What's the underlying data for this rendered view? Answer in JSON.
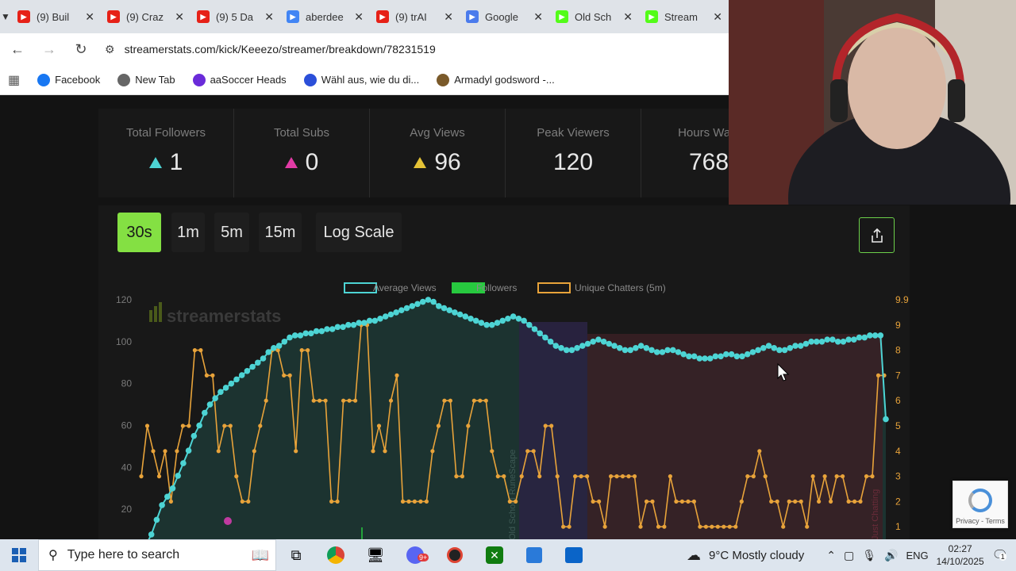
{
  "browser": {
    "tabs": [
      {
        "title": "(9) Buil",
        "icon": "youtube-icon",
        "color": "#e62117"
      },
      {
        "title": "(9) Craz",
        "icon": "youtube-icon",
        "color": "#e62117"
      },
      {
        "title": "(9) 5 Da",
        "icon": "youtube-icon",
        "color": "#e62117"
      },
      {
        "title": "aberdee",
        "icon": "google-icon",
        "color": "#4285f4"
      },
      {
        "title": "(9) trAI",
        "icon": "youtube-icon",
        "color": "#e62117"
      },
      {
        "title": "Google",
        "icon": "gemini-icon",
        "color": "#4b7bec"
      },
      {
        "title": "Old Sch",
        "icon": "kick-icon",
        "color": "#53fc18"
      },
      {
        "title": "Stream",
        "icon": "kick-icon",
        "color": "#53fc18"
      }
    ],
    "url": "streamerstats.com/kick/Keeezo/streamer/breakdown/78231519",
    "bookmarks": [
      {
        "label": "Facebook",
        "color": "#1877f2"
      },
      {
        "label": "New Tab",
        "color": "#666666"
      },
      {
        "label": "aaSoccer Heads",
        "color": "#6a2bd9"
      },
      {
        "label": "Wähl aus, wie du di...",
        "color": "#2b4fd9"
      },
      {
        "label": "Armadyl godsword -...",
        "color": "#7a5a2a"
      }
    ]
  },
  "stats": [
    {
      "label": "Total Followers",
      "value": "1",
      "marker": "#4dd4d4"
    },
    {
      "label": "Total Subs",
      "value": "0",
      "marker": "#e23ba6"
    },
    {
      "label": "Avg Views",
      "value": "96",
      "marker": "#e4c236"
    },
    {
      "label": "Peak Viewers",
      "value": "120",
      "marker": ""
    },
    {
      "label": "Hours Watc",
      "value": "768",
      "marker": ""
    }
  ],
  "controls": {
    "intervals": [
      "30s",
      "1m",
      "5m",
      "15m"
    ],
    "active_interval": "30s",
    "log_scale_label": "Log Scale"
  },
  "chart_data": {
    "type": "line",
    "watermark": "streamerstats",
    "series": [
      {
        "name": "Average Views",
        "axis": "left",
        "color": "#4dd4d4",
        "values": [
          3,
          8,
          15,
          22,
          26,
          30,
          36,
          42,
          48,
          55,
          60,
          66,
          70,
          73,
          76,
          78,
          80,
          82,
          84,
          86,
          88,
          90,
          92,
          95,
          97,
          98,
          100,
          102,
          103,
          103,
          104,
          104,
          105,
          105,
          106,
          106,
          107,
          107,
          108,
          108,
          109,
          109,
          110,
          110,
          111,
          112,
          113,
          114,
          115,
          116,
          117,
          118,
          119,
          120,
          119,
          117,
          116,
          115,
          114,
          113,
          112,
          111,
          110,
          109,
          108,
          108,
          109,
          110,
          111,
          112,
          111,
          110,
          108,
          106,
          104,
          102,
          100,
          98,
          97,
          96,
          96,
          97,
          98,
          99,
          100,
          101,
          100,
          99,
          98,
          97,
          96,
          96,
          97,
          98,
          97,
          96,
          95,
          95,
          96,
          96,
          95,
          94,
          93,
          93,
          92,
          92,
          92,
          93,
          93,
          94,
          94,
          93,
          93,
          94,
          95,
          96,
          97,
          98,
          97,
          96,
          96,
          97,
          98,
          98,
          99,
          100,
          100,
          100,
          101,
          101,
          100,
          100,
          101,
          101,
          102,
          102,
          103,
          103,
          103,
          63
        ]
      },
      {
        "name": "Followers",
        "axis": "right",
        "color": "#27c93f",
        "values": []
      },
      {
        "name": "Unique Chatters (5m)",
        "axis": "right",
        "color": "#e8a33a",
        "values": [
          3,
          5,
          4,
          3,
          4,
          2,
          4,
          5,
          5,
          8,
          8,
          7,
          7,
          4,
          5,
          5,
          3,
          2,
          2,
          4,
          5,
          6,
          8,
          8,
          7,
          7,
          4,
          8,
          8,
          6,
          6,
          6,
          2,
          2,
          6,
          6,
          6,
          9,
          9,
          4,
          5,
          4,
          6,
          7,
          2,
          2,
          2,
          2,
          2,
          4,
          5,
          6,
          6,
          3,
          3,
          5,
          6,
          6,
          6,
          4,
          3,
          3,
          2,
          2,
          3,
          4,
          4,
          3,
          5,
          5,
          3,
          1,
          1,
          3,
          3,
          3,
          2,
          2,
          1,
          3,
          3,
          3,
          3,
          3,
          1,
          2,
          2,
          1,
          1,
          3,
          2,
          2,
          2,
          2,
          1,
          1,
          1,
          1,
          1,
          1,
          1,
          2,
          3,
          3,
          4,
          3,
          2,
          2,
          1,
          2,
          2,
          2,
          1,
          3,
          2,
          3,
          2,
          3,
          3,
          2,
          2,
          2,
          3,
          3,
          7,
          7
        ]
      }
    ],
    "y_left": {
      "min": 0,
      "max": 120,
      "ticks": [
        "20",
        "40",
        "60",
        "80",
        "100",
        "120"
      ]
    },
    "y_right": {
      "ticks": [
        "1",
        "2",
        "3",
        "4",
        "5",
        "6",
        "7",
        "8",
        "9",
        "9.9"
      ]
    },
    "regions": [
      {
        "label": "Old School RuneScape",
        "color": "#1f3a34"
      },
      {
        "label": "",
        "color": "#2a2340"
      },
      {
        "label": "Just Chatting",
        "color": "#3a2024"
      }
    ]
  },
  "taskbar": {
    "search_placeholder": "Type here to search",
    "weather": "9°C  Mostly cloudy",
    "language": "ENG",
    "time": "02:27",
    "date": "14/10/2025",
    "notification_count": "1",
    "discord_badge": "9+"
  },
  "recaptcha": {
    "links": "Privacy - Terms"
  }
}
